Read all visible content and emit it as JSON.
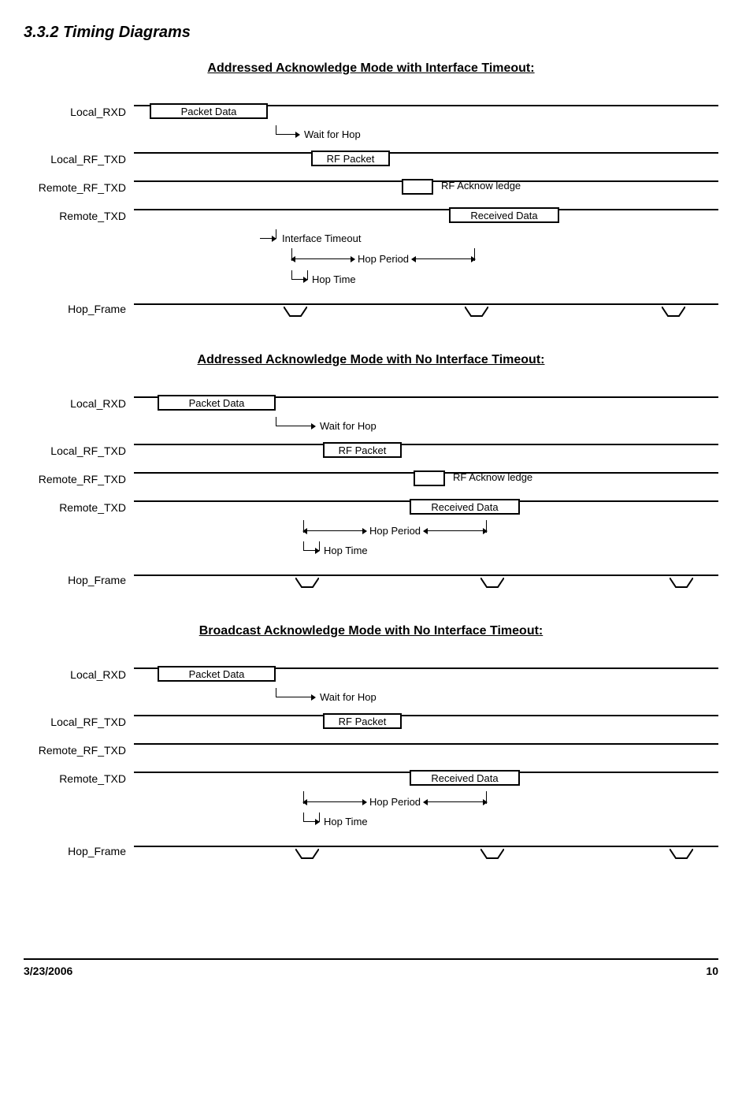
{
  "heading": "3.3.2  Timing Diagrams",
  "diagrams": [
    {
      "title": "Addressed Acknowledge Mode with Interface Timeout:",
      "signals": {
        "local_rxd": "Local_RXD",
        "local_rf_txd": "Local_RF_TXD",
        "remote_rf_txd": "Remote_RF_TXD",
        "remote_txd": "Remote_TXD",
        "hop_frame": "Hop_Frame"
      },
      "bubbles": {
        "packet_data": "Packet Data",
        "rf_packet": "RF Packet",
        "rf_ack": "RF Acknow ledge",
        "received_data": "Received Data"
      },
      "annotations": {
        "wait_for_hop": "Wait for Hop",
        "interface_timeout": "Interface Timeout",
        "hop_period": "Hop Period",
        "hop_time": "Hop Time"
      }
    },
    {
      "title": "Addressed Acknowledge Mode with No Interface Timeout:",
      "signals": {
        "local_rxd": "Local_RXD",
        "local_rf_txd": "Local_RF_TXD",
        "remote_rf_txd": "Remote_RF_TXD",
        "remote_txd": "Remote_TXD",
        "hop_frame": "Hop_Frame"
      },
      "bubbles": {
        "packet_data": "Packet Data",
        "rf_packet": "RF Packet",
        "rf_ack": "RF Acknow ledge",
        "received_data": "Received Data"
      },
      "annotations": {
        "wait_for_hop": "Wait for Hop",
        "hop_period": "Hop Period",
        "hop_time": "Hop Time"
      }
    },
    {
      "title": "Broadcast Acknowledge Mode with No Interface Timeout:",
      "signals": {
        "local_rxd": "Local_RXD",
        "local_rf_txd": "Local_RF_TXD",
        "remote_rf_txd": "Remote_RF_TXD",
        "remote_txd": "Remote_TXD",
        "hop_frame": "Hop_Frame"
      },
      "bubbles": {
        "packet_data": "Packet Data",
        "rf_packet": "RF Packet",
        "received_data": "Received Data"
      },
      "annotations": {
        "wait_for_hop": "Wait for Hop",
        "hop_period": "Hop Period",
        "hop_time": "Hop Time"
      }
    }
  ],
  "footer": {
    "date": "3/23/2006",
    "page": "10"
  }
}
